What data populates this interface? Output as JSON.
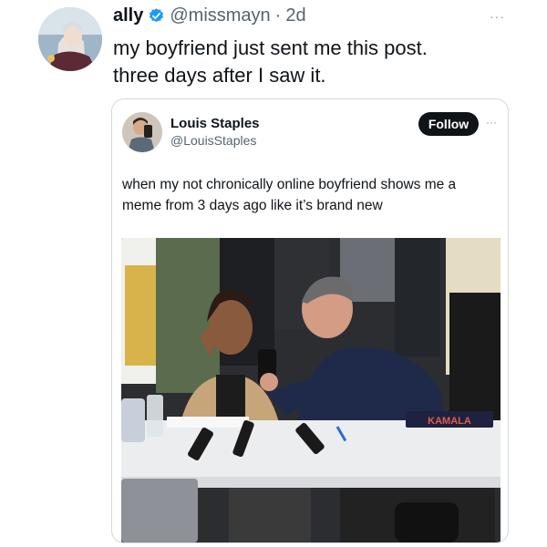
{
  "tweet": {
    "author_name": "ally",
    "author_handle": "@missmayn",
    "separator": "·",
    "time": "2d",
    "more": "···",
    "text_line1": "my boyfriend just sent me this post.",
    "text_line2": "three days after I saw it."
  },
  "quoted": {
    "author_name": "Louis Staples",
    "author_handle": "@LouisStaples",
    "follow_label": "Follow",
    "more": "···",
    "text_line1": "when my not chronically online boyfriend shows me a",
    "text_line2": "meme from 3 days ago like it’s brand new",
    "photo": {
      "nameplate_text": "KAMALA"
    }
  },
  "colors": {
    "verified_badge": "#1d9bf0",
    "follow_bg": "#0f1419",
    "muted_text": "#536471",
    "border": "#cfd9de"
  },
  "icons": {
    "verified": "verified-badge-icon",
    "more": "more-dots-icon"
  }
}
